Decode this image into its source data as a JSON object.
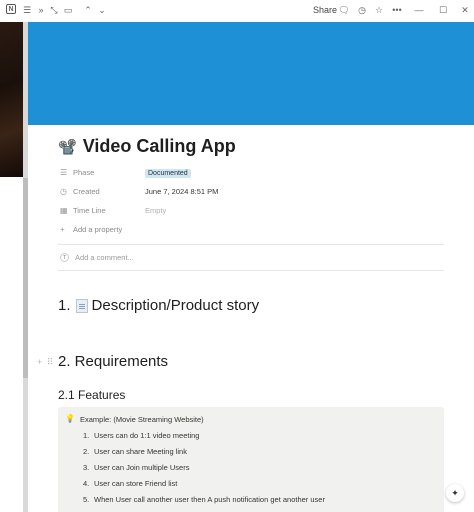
{
  "topbar": {
    "share_label": "Share",
    "icons": [
      "notion-logo-icon",
      "menu-icon",
      "double-chevron-icon",
      "collapse-icon",
      "sidebar-icon",
      "chevron-up-icon",
      "chevron-down-icon",
      "comment-icon",
      "history-icon",
      "star-icon",
      "more-icon",
      "minimize-icon",
      "maximize-icon",
      "close-icon"
    ]
  },
  "cover": {
    "color": "#1e90d6"
  },
  "page": {
    "title_emoji": "📽️",
    "title": "Video Calling App",
    "properties": [
      {
        "icon": "list-icon",
        "label": "Phase",
        "value": "Documented",
        "type": "badge"
      },
      {
        "icon": "clock-icon",
        "label": "Created",
        "value": "June 7, 2024 8:51 PM",
        "type": "text"
      },
      {
        "icon": "calendar-icon",
        "label": "Time Line",
        "value": "Empty",
        "type": "empty"
      }
    ],
    "add_property": "Add a property",
    "comment_placeholder": "Add a comment...",
    "heading1_num": "1.",
    "heading1": "Description/Product story",
    "heading2": "2. Requirements",
    "heading3": "2.1 Features",
    "callout": {
      "icon": "💡",
      "title": "Example: (Movie Streaming Website)",
      "items": [
        {
          "num": "1.",
          "text": "Users can do 1:1 video meeting"
        },
        {
          "num": "2.",
          "text": "User can share Meeting link"
        },
        {
          "num": "3.",
          "text": "User can Join multiple Users"
        },
        {
          "num": "4.",
          "text": "User can store Friend list"
        },
        {
          "num": "5.",
          "text": "When User call another user then A push notification get another user"
        }
      ]
    }
  }
}
